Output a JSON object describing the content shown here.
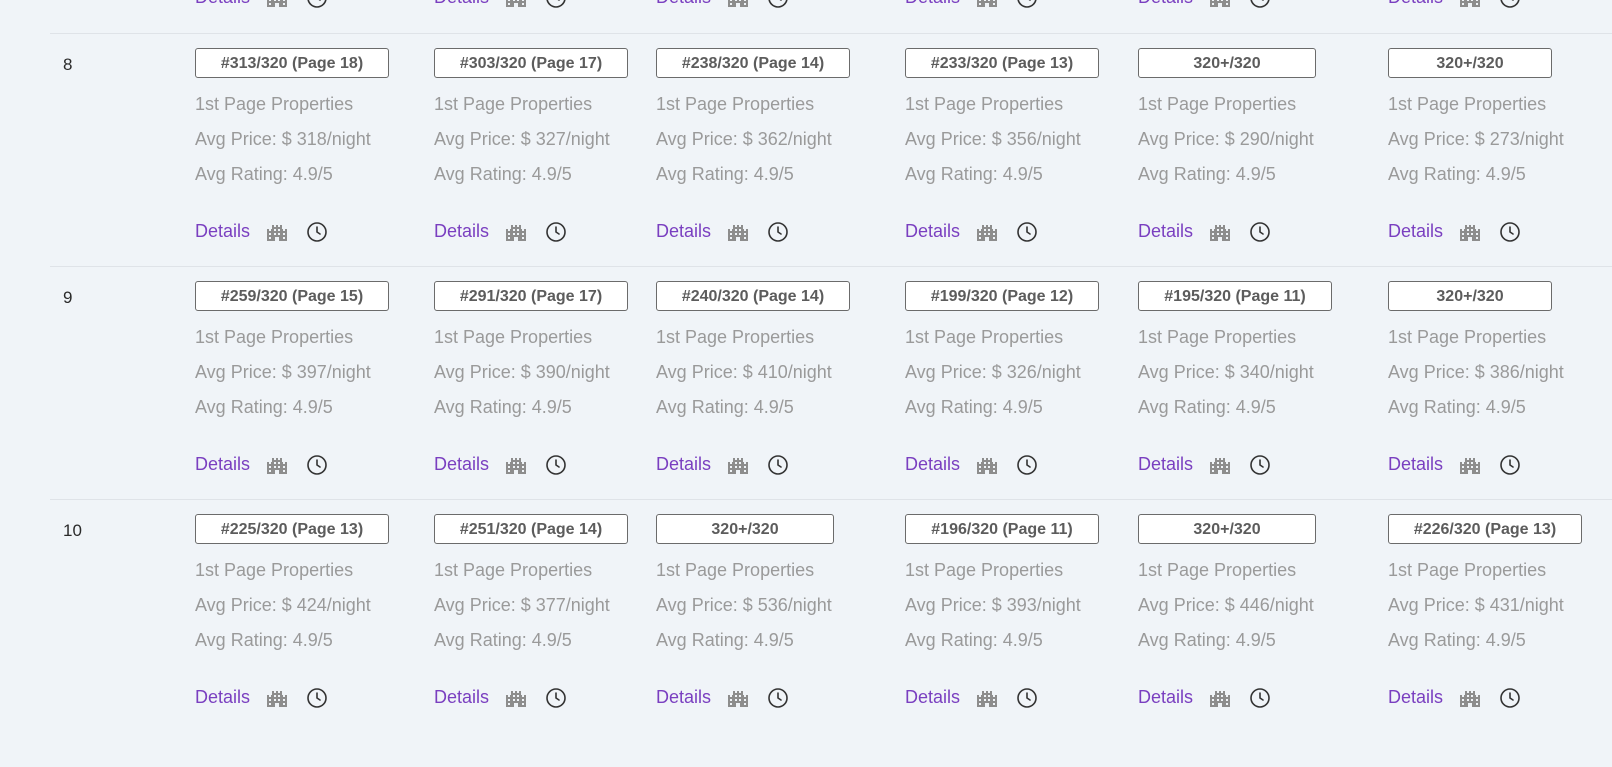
{
  "accent_color": "#7a3fc0",
  "icons": {
    "building": "building-icon",
    "history": "history-icon"
  },
  "top_partial_row": {
    "cells": [
      {
        "details": "Details"
      },
      {
        "details": "Details"
      },
      {
        "details": "Details"
      },
      {
        "details": "Details"
      },
      {
        "details": "Details"
      },
      {
        "details": "Details"
      }
    ]
  },
  "rows": [
    {
      "num": "8",
      "cells": [
        {
          "rank": "#313/320 (Page 18)",
          "label": "1st Page Properties",
          "price": "Avg Price: $ 318/night",
          "rating": "Avg Rating: 4.9/5",
          "details": "Details"
        },
        {
          "rank": "#303/320 (Page 17)",
          "label": "1st Page Properties",
          "price": "Avg Price: $ 327/night",
          "rating": "Avg Rating: 4.9/5",
          "details": "Details"
        },
        {
          "rank": "#238/320 (Page 14)",
          "label": "1st Page Properties",
          "price": "Avg Price: $ 362/night",
          "rating": "Avg Rating: 4.9/5",
          "details": "Details"
        },
        {
          "rank": "#233/320 (Page 13)",
          "label": "1st Page Properties",
          "price": "Avg Price: $ 356/night",
          "rating": "Avg Rating: 4.9/5",
          "details": "Details"
        },
        {
          "rank": "320+/320",
          "label": "1st Page Properties",
          "price": "Avg Price: $ 290/night",
          "rating": "Avg Rating: 4.9/5",
          "details": "Details"
        },
        {
          "rank": "320+/320",
          "label": "1st Page Properties",
          "price": "Avg Price: $ 273/night",
          "rating": "Avg Rating: 4.9/5",
          "details": "Details"
        }
      ]
    },
    {
      "num": "9",
      "cells": [
        {
          "rank": "#259/320 (Page 15)",
          "label": "1st Page Properties",
          "price": "Avg Price: $ 397/night",
          "rating": "Avg Rating: 4.9/5",
          "details": "Details"
        },
        {
          "rank": "#291/320 (Page 17)",
          "label": "1st Page Properties",
          "price": "Avg Price: $ 390/night",
          "rating": "Avg Rating: 4.9/5",
          "details": "Details"
        },
        {
          "rank": "#240/320 (Page 14)",
          "label": "1st Page Properties",
          "price": "Avg Price: $ 410/night",
          "rating": "Avg Rating: 4.9/5",
          "details": "Details"
        },
        {
          "rank": "#199/320 (Page 12)",
          "label": "1st Page Properties",
          "price": "Avg Price: $ 326/night",
          "rating": "Avg Rating: 4.9/5",
          "details": "Details"
        },
        {
          "rank": "#195/320 (Page 11)",
          "label": "1st Page Properties",
          "price": "Avg Price: $ 340/night",
          "rating": "Avg Rating: 4.9/5",
          "details": "Details"
        },
        {
          "rank": "320+/320",
          "label": "1st Page Properties",
          "price": "Avg Price: $ 386/night",
          "rating": "Avg Rating: 4.9/5",
          "details": "Details"
        }
      ]
    },
    {
      "num": "10",
      "cells": [
        {
          "rank": "#225/320 (Page 13)",
          "label": "1st Page Properties",
          "price": "Avg Price: $ 424/night",
          "rating": "Avg Rating: 4.9/5",
          "details": "Details"
        },
        {
          "rank": "#251/320 (Page 14)",
          "label": "1st Page Properties",
          "price": "Avg Price: $ 377/night",
          "rating": "Avg Rating: 4.9/5",
          "details": "Details"
        },
        {
          "rank": "320+/320",
          "label": "1st Page Properties",
          "price": "Avg Price: $ 536/night",
          "rating": "Avg Rating: 4.9/5",
          "details": "Details"
        },
        {
          "rank": "#196/320 (Page 11)",
          "label": "1st Page Properties",
          "price": "Avg Price: $ 393/night",
          "rating": "Avg Rating: 4.9/5",
          "details": "Details"
        },
        {
          "rank": "320+/320",
          "label": "1st Page Properties",
          "price": "Avg Price: $ 446/night",
          "rating": "Avg Rating: 4.9/5",
          "details": "Details"
        },
        {
          "rank": "#226/320 (Page 13)",
          "label": "1st Page Properties",
          "price": "Avg Price: $ 431/night",
          "rating": "Avg Rating: 4.9/5",
          "details": "Details"
        }
      ]
    }
  ]
}
